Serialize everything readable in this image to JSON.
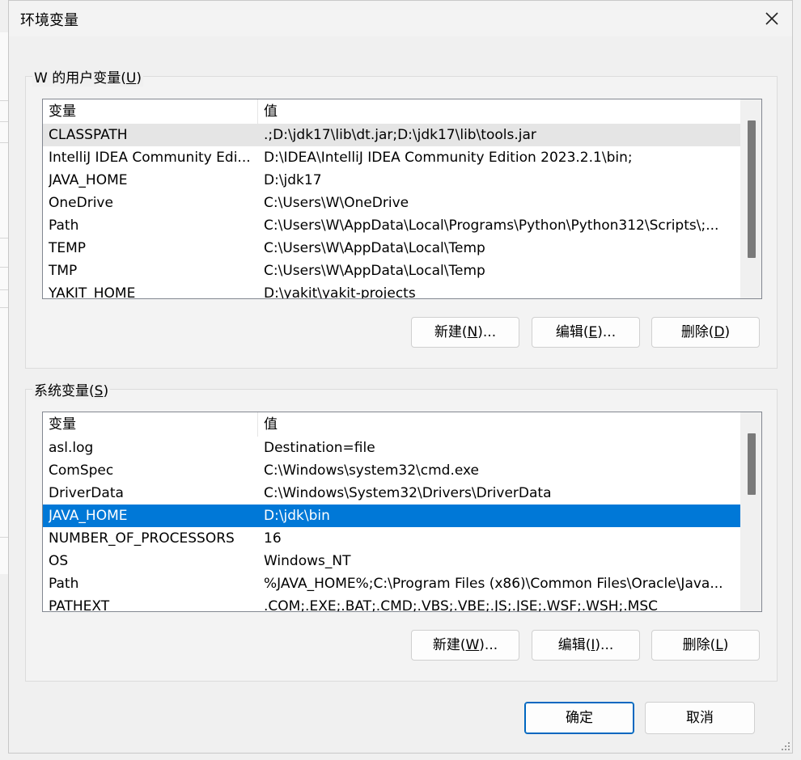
{
  "dialog": {
    "title": "环境变量",
    "ok_label": "确定",
    "cancel_label": "取消"
  },
  "user_vars": {
    "group_label": "W 的用户变量(",
    "group_accel": "U",
    "group_suffix": ")",
    "col_name": "变量",
    "col_value": "值",
    "rows": [
      {
        "name": "CLASSPATH",
        "value": ".;D:\\jdk17\\lib\\dt.jar;D:\\jdk17\\lib\\tools.jar"
      },
      {
        "name": "IntelliJ IDEA Community Edi...",
        "value": "D:\\IDEA\\IntelliJ IDEA Community Edition 2023.2.1\\bin;"
      },
      {
        "name": "JAVA_HOME",
        "value": "D:\\jdk17"
      },
      {
        "name": "OneDrive",
        "value": "C:\\Users\\W\\OneDrive"
      },
      {
        "name": "Path",
        "value": "C:\\Users\\W\\AppData\\Local\\Programs\\Python\\Python312\\Scripts\\;..."
      },
      {
        "name": "TEMP",
        "value": "C:\\Users\\W\\AppData\\Local\\Temp"
      },
      {
        "name": "TMP",
        "value": "C:\\Users\\W\\AppData\\Local\\Temp"
      },
      {
        "name": "YAKIT_HOME",
        "value": "D:\\yakit\\yakit-projects"
      }
    ],
    "buttons": [
      {
        "pre": "新建(",
        "accel": "N",
        "post": ")..."
      },
      {
        "pre": "编辑(",
        "accel": "E",
        "post": ")..."
      },
      {
        "pre": "删除(",
        "accel": "D",
        "post": ")"
      }
    ]
  },
  "system_vars": {
    "group_label": "系统变量(",
    "group_accel": "S",
    "group_suffix": ")",
    "col_name": "变量",
    "col_value": "值",
    "rows": [
      {
        "name": "asl.log",
        "value": "Destination=file"
      },
      {
        "name": "ComSpec",
        "value": "C:\\Windows\\system32\\cmd.exe"
      },
      {
        "name": "DriverData",
        "value": "C:\\Windows\\System32\\Drivers\\DriverData"
      },
      {
        "name": "JAVA_HOME",
        "value": "D:\\jdk\\bin"
      },
      {
        "name": "NUMBER_OF_PROCESSORS",
        "value": "16"
      },
      {
        "name": "OS",
        "value": "Windows_NT"
      },
      {
        "name": "Path",
        "value": "%JAVA_HOME%;C:\\Program Files (x86)\\Common Files\\Oracle\\Java..."
      },
      {
        "name": "PATHEXT",
        "value": ".COM;.EXE;.BAT;.CMD;.VBS;.VBE;.JS;.JSE;.WSF;.WSH;.MSC"
      }
    ],
    "buttons": [
      {
        "pre": "新建(",
        "accel": "W",
        "post": ")..."
      },
      {
        "pre": "编辑(",
        "accel": "I",
        "post": ")..."
      },
      {
        "pre": "删除(",
        "accel": "L",
        "post": ")"
      }
    ]
  },
  "colors": {
    "selection": "#0078d7",
    "hover": "#e5e5e5",
    "primary_border": "#0067c0"
  },
  "icons": {
    "close": "close-icon",
    "resize": "resize-grip-icon"
  }
}
